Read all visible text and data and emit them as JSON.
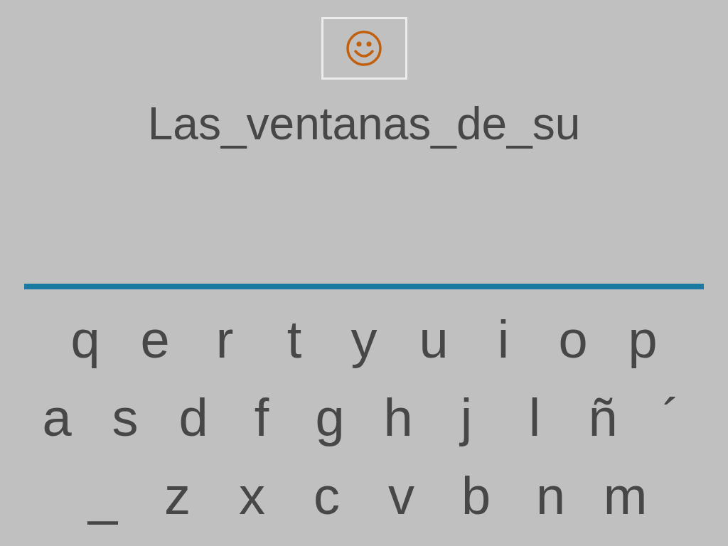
{
  "title": "Las_ventanas_de_su",
  "keyboard": {
    "rows": [
      {
        "keys": [
          "q",
          "e",
          "r",
          "t",
          "y",
          "u",
          "i",
          "o",
          "p"
        ]
      },
      {
        "keys": [
          "a",
          "s",
          "d",
          "f",
          "g",
          "h",
          "j",
          "l",
          "ñ",
          "´"
        ]
      },
      {
        "keys": [
          "_",
          "z",
          "x",
          "c",
          "v",
          "b",
          "n",
          "m"
        ]
      }
    ]
  }
}
